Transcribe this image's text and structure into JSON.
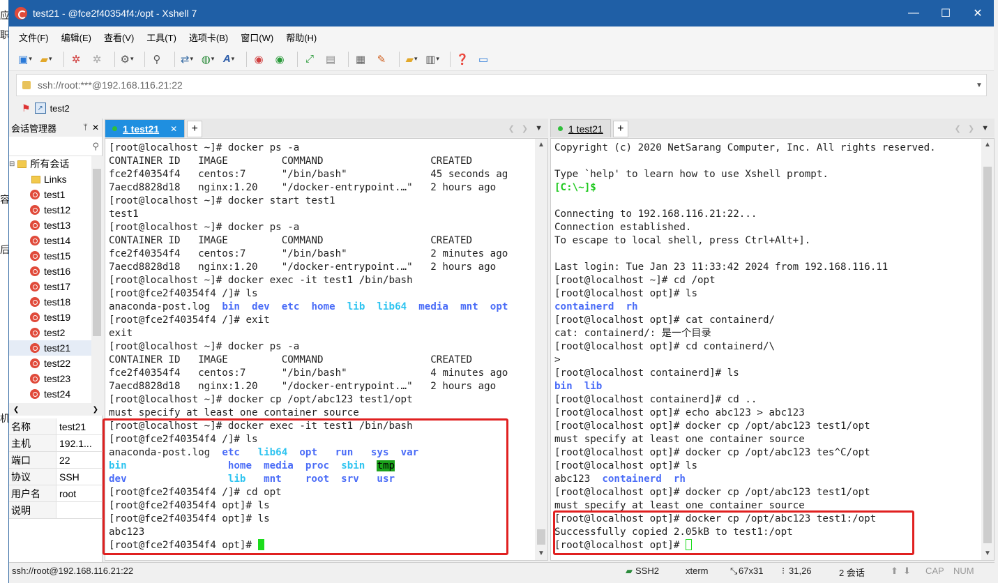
{
  "window": {
    "title": "test21 - @fce2f40354f4:/opt - Xshell 7",
    "minimize": "—",
    "maximize": "☐",
    "close": "✕"
  },
  "menu": [
    "文件(F)",
    "编辑(E)",
    "查看(V)",
    "工具(T)",
    "选项卡(B)",
    "窗口(W)",
    "帮助(H)"
  ],
  "address": {
    "value": "ssh://root:***@192.168.116.21:22"
  },
  "linkbar": {
    "link": "test2"
  },
  "session_manager": {
    "title": "会话管理器",
    "pin": "ᛘ",
    "close": "✕",
    "root": "所有会话",
    "items": [
      "Links",
      "test1",
      "test12",
      "test13",
      "test14",
      "test15",
      "test16",
      "test17",
      "test18",
      "test19",
      "test2",
      "test21",
      "test22",
      "test23",
      "test24"
    ],
    "selected": "test21",
    "properties": [
      {
        "key": "名称",
        "value": "test21"
      },
      {
        "key": "主机",
        "value": "192.1..."
      },
      {
        "key": "端口",
        "value": "22"
      },
      {
        "key": "协议",
        "value": "SSH"
      },
      {
        "key": "用户名",
        "value": "root"
      },
      {
        "key": "说明",
        "value": ""
      }
    ]
  },
  "tabs": {
    "left": {
      "label": "1 test21",
      "close": "✕",
      "add": "+"
    },
    "right": {
      "label": "1 test21",
      "add": "+"
    }
  },
  "terminal_left": {
    "lines": [
      "[root@localhost ~]# docker ps -a",
      "CONTAINER ID   IMAGE         COMMAND                  CREATED",
      "fce2f40354f4   centos:7      \"/bin/bash\"              45 seconds ag",
      "7aecd8828d18   nginx:1.20    \"/docker-entrypoint.…\"   2 hours ago",
      "[root@localhost ~]# docker start test1",
      "test1",
      "[root@localhost ~]# docker ps -a",
      "CONTAINER ID   IMAGE         COMMAND                  CREATED",
      "fce2f40354f4   centos:7      \"/bin/bash\"              2 minutes ago",
      "7aecd8828d18   nginx:1.20    \"/docker-entrypoint.…\"   2 hours ago",
      "[root@localhost ~]# docker exec -it test1 /bin/bash",
      "[root@fce2f40354f4 /]# ls",
      "anaconda-post.log",
      "[root@fce2f40354f4 /]# exit",
      "exit",
      "[root@localhost ~]# docker ps -a",
      "CONTAINER ID   IMAGE         COMMAND                  CREATED",
      "fce2f40354f4   centos:7      \"/bin/bash\"              4 minutes ago",
      "7aecd8828d18   nginx:1.20    \"/docker-entrypoint.…\"   2 hours ago",
      "[root@localhost ~]# docker cp /opt/abc123 test1/opt",
      "must specify at least one container source",
      "[root@localhost ~]# docker exec -it test1 /bin/bash",
      "[root@fce2f40354f4 /]# ls",
      "anaconda-post.log",
      "[root@fce2f40354f4 /]# cd opt",
      "[root@fce2f40354f4 opt]# ls",
      "[root@fce2f40354f4 opt]# ls",
      "abc123",
      "[root@fce2f40354f4 opt]# "
    ],
    "ls1_dirs": [
      "bin",
      "dev",
      "etc",
      "home",
      "lib",
      "lib64",
      "media",
      "mnt",
      "opt"
    ],
    "ls2_row1": [
      "etc",
      "lib64",
      "opt",
      "run",
      "sys",
      "var"
    ],
    "ls2_row2": [
      "bin",
      "home",
      "media",
      "proc",
      "sbin",
      "tmp"
    ],
    "ls2_row3": [
      "dev",
      "lib",
      "mnt",
      "root",
      "srv",
      "usr"
    ]
  },
  "terminal_right": {
    "lines": [
      "Copyright (c) 2020 NetSarang Computer, Inc. All rights reserved.",
      "",
      "Type `help' to learn how to use Xshell prompt.",
      "[C:\\~]$",
      "",
      "Connecting to 192.168.116.21:22...",
      "Connection established.",
      "To escape to local shell, press Ctrl+Alt+].",
      "",
      "Last login: Tue Jan 23 11:33:42 2024 from 192.168.116.11",
      "[root@localhost ~]# cd /opt",
      "[root@localhost opt]# ls",
      "containerd  rh",
      "[root@localhost opt]# cat containerd/",
      "cat: containerd/: 是一个目录",
      "[root@localhost opt]# cd containerd/\\",
      "> ",
      "[root@localhost containerd]# ls",
      "bin  lib",
      "[root@localhost containerd]# cd ..",
      "[root@localhost opt]# echo abc123 > abc123",
      "[root@localhost opt]# docker cp /opt/abc123 test1/opt",
      "must specify at least one container source",
      "[root@localhost opt]# docker cp /opt/abc123 tes^C/opt",
      "[root@localhost opt]# ls",
      "abc123",
      "[root@localhost opt]# docker cp /opt/abc123 test1/opt",
      "must specify at least one container source",
      "[root@localhost opt]# docker cp /opt/abc123 test1:/opt",
      "Successfully copied 2.05kB to test1:/opt",
      "[root@localhost opt]# "
    ],
    "ls_opt_dirs": [
      "containerd",
      "rh"
    ],
    "ls_containerd_dirs": [
      "bin",
      "lib"
    ],
    "ls_final_dirs": [
      "containerd",
      "rh"
    ]
  },
  "statusbar": {
    "connection": "ssh://root@192.168.116.21:22",
    "protocol": "SSH2",
    "terminal": "xterm",
    "size": "67x31",
    "position": "31,26",
    "sessions": "2 会话",
    "cap": "CAP",
    "num": "NUM"
  },
  "background_text": [
    "应",
    "职",
    "容",
    "后",
    "机"
  ],
  "colors": {
    "titlebar": "#1f5fa6",
    "active_tab": "#1f8fe0",
    "dir_blue": "#4a6cf7",
    "dir_cyan": "#2fc4f0",
    "cursor_green": "#1cdc1c",
    "highlight_red": "#e02020"
  }
}
